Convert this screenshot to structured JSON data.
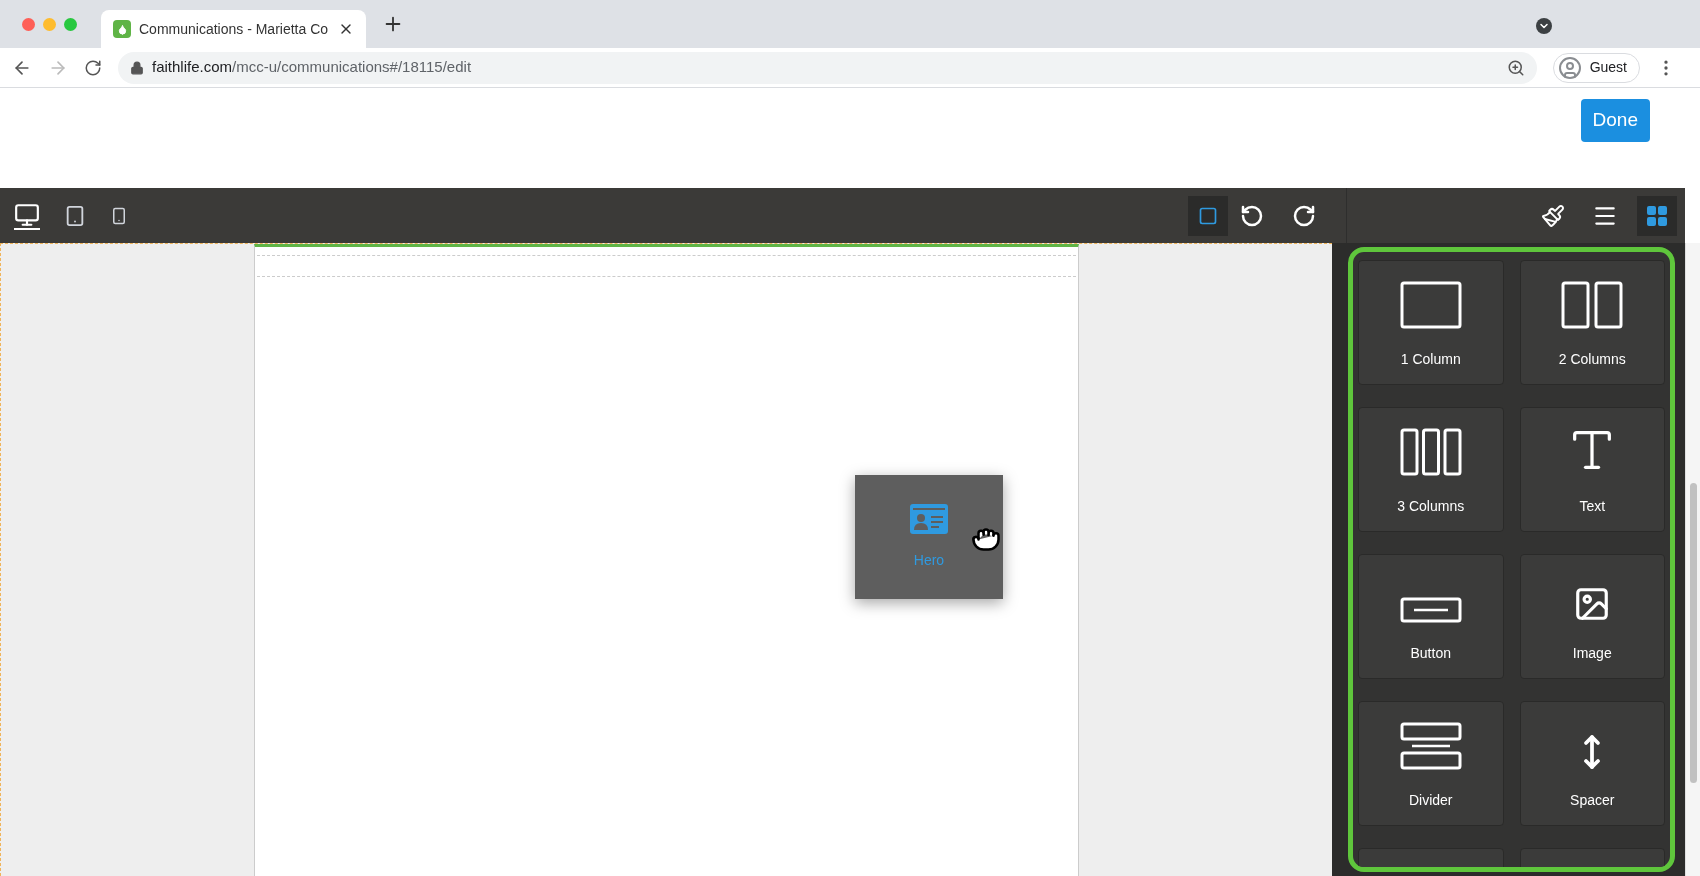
{
  "browser": {
    "tab_title": "Communications - Marietta Co",
    "url_host": "faithlife.com",
    "url_path": "/mcc-u/communications#/18115/edit",
    "profile": "Guest"
  },
  "header": {
    "done_button": "Done"
  },
  "toolbar": {
    "devices": [
      {
        "kind": "desktop",
        "selected": true
      },
      {
        "kind": "tablet",
        "selected": false
      },
      {
        "kind": "phone",
        "selected": false
      }
    ],
    "outline_toggle": {
      "on": true
    }
  },
  "panel_tabs": [
    {
      "kind": "style",
      "selected": false
    },
    {
      "kind": "layers",
      "selected": false
    },
    {
      "kind": "blocks",
      "selected": true
    }
  ],
  "dragged_block": {
    "label": "Hero",
    "kind": "hero"
  },
  "blocks": [
    {
      "label": "1 Column",
      "kind": "col1"
    },
    {
      "label": "2 Columns",
      "kind": "col2"
    },
    {
      "label": "3 Columns",
      "kind": "col3"
    },
    {
      "label": "Text",
      "kind": "text"
    },
    {
      "label": "Button",
      "kind": "button"
    },
    {
      "label": "Image",
      "kind": "image"
    },
    {
      "label": "Divider",
      "kind": "divider"
    },
    {
      "label": "Spacer",
      "kind": "spacer"
    }
  ]
}
